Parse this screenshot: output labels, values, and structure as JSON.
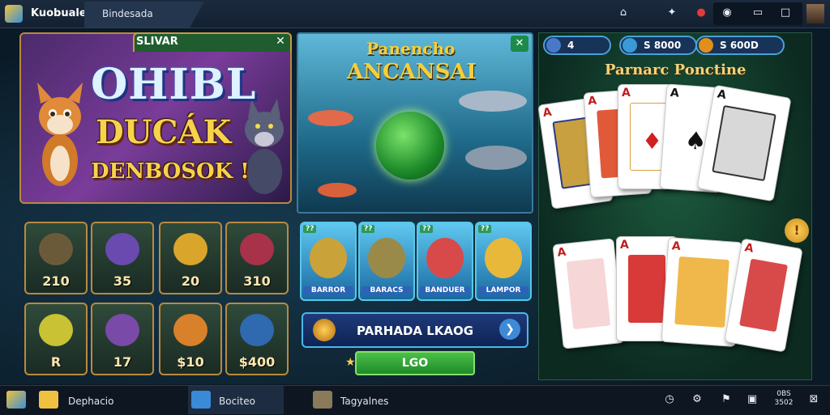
{
  "window": {
    "app_title": "Kuobuale",
    "tab_label": "Bindesada",
    "top_icons": [
      "home-icon",
      "settings-icon",
      "alert-icon",
      "record-icon",
      "minimize-icon",
      "maximize-icon",
      "profile-picture-icon"
    ]
  },
  "left_panel": {
    "header_title": "SLIVAR",
    "close_label": "✕",
    "promo_line1": "OHIBL",
    "promo_line2": "DUCÁK",
    "promo_line3": "DENBOSOK !"
  },
  "items": [
    {
      "label": "210",
      "art_color": "#6b5a3a"
    },
    {
      "label": "35",
      "art_color": "#6b4ab0"
    },
    {
      "label": "20",
      "art_color": "#d9a52a"
    },
    {
      "label": "310",
      "art_color": "#a8324a"
    },
    {
      "label": "R",
      "art_color": "#c8c234"
    },
    {
      "label": "17",
      "art_color": "#7a4aa8"
    },
    {
      "label": "$10",
      "art_color": "#d9802a"
    },
    {
      "label": "$400",
      "art_color": "#2f6ab0"
    }
  ],
  "middle_panel": {
    "title_line1": "Panencho",
    "title_line2": "ANCANSAI",
    "close_label": "✕",
    "cards": [
      {
        "tag": "??",
        "label": "BARROR",
        "art_color": "#caa23a"
      },
      {
        "tag": "??",
        "label": "BARACS",
        "art_color": "#9a8a4a"
      },
      {
        "tag": "??",
        "label": "BANDUER",
        "art_color": "#d84a4a"
      },
      {
        "tag": "??",
        "label": "LAMPOR",
        "art_color": "#e8b83a"
      }
    ],
    "action_label": "PARHADA LKAOG",
    "go_label": "LGO"
  },
  "right_panel": {
    "chips": [
      {
        "value": "4",
        "coin": "#4a78c8"
      },
      {
        "value": "S  8000",
        "coin": "#3a9ad8"
      },
      {
        "value": "S  600D",
        "coin": "#e0901a"
      }
    ],
    "title": "Parnarc Ponctine",
    "badge": "!"
  },
  "taskbar": {
    "items": [
      {
        "label": "Dephacio"
      },
      {
        "label": "Bociteo"
      },
      {
        "label": "Tagyalnes"
      }
    ],
    "clock": "0BS",
    "date": "3502"
  },
  "colors": {
    "accent_gold": "#f3d27a",
    "panel_green": "#1c5a3e",
    "water_blue": "#5fb8d8"
  }
}
